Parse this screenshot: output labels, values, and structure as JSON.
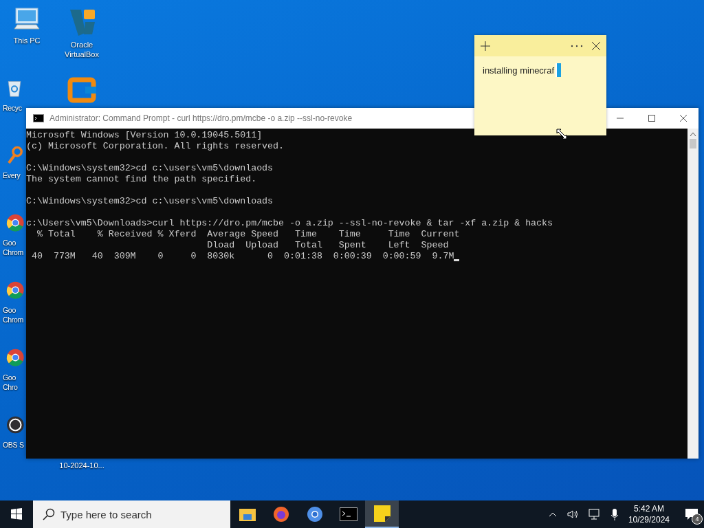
{
  "desktop": {
    "columns": [
      {
        "icons": [
          {
            "kind": "computer",
            "label": "This PC"
          },
          {
            "kind": "recycle",
            "label": "Recyc"
          },
          {
            "kind": "everything",
            "label": "Every"
          },
          {
            "kind": "chrome",
            "label": "Goo\nChrom"
          },
          {
            "kind": "chrome",
            "label": "Goo\nChrom"
          },
          {
            "kind": "chrome",
            "label": "Goo\nChro"
          },
          {
            "kind": "obs",
            "label": "OBS S"
          }
        ]
      },
      {
        "icons": [
          {
            "kind": "virtualbox",
            "label": "Oracle\nVirtualBox"
          },
          {
            "kind": "orange-app"
          },
          {
            "kind": "file",
            "label": "10-2024-10..."
          }
        ]
      }
    ]
  },
  "command_prompt": {
    "title": "Administrator: Command Prompt - curl  https://dro.pm/mcbe -o a.zip --ssl-no-revoke",
    "blocks": [
      [
        "Microsoft Windows [Version 10.0.19045.5011]",
        "(c) Microsoft Corporation. All rights reserved."
      ],
      [
        "C:\\Windows\\system32>cd c:\\users\\vm5\\downlaods",
        "The system cannot find the path specified."
      ],
      [
        "C:\\Windows\\system32>cd c:\\users\\vm5\\downloads"
      ],
      [
        "c:\\Users\\vm5\\Downloads>curl https://dro.pm/mcbe -o a.zip --ssl-no-revoke & tar -xf a.zip & hacks",
        "  % Total    % Received % Xferd  Average Speed   Time    Time     Time  Current",
        "                                 Dload  Upload   Total   Spent    Left  Speed",
        " 40  773M   40  309M    0     0  8030k      0  0:01:38  0:00:39  0:00:59  9.7M"
      ]
    ]
  },
  "sticky_note": {
    "text": "installing minecraf"
  },
  "taskbar": {
    "search": {
      "placeholder": "Type here to search"
    },
    "apps": [
      {
        "kind": "explorer",
        "selected": false
      },
      {
        "kind": "firefox",
        "selected": false
      },
      {
        "kind": "chrome",
        "selected": false
      },
      {
        "kind": "terminal",
        "selected": false
      },
      {
        "kind": "sticky",
        "selected": true
      }
    ],
    "time": "5:42 AM",
    "date": "10/29/2024",
    "notifications": "4"
  }
}
